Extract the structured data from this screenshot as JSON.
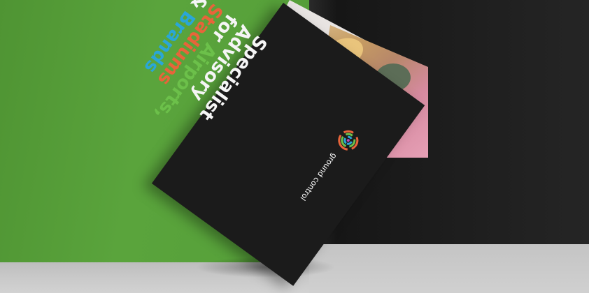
{
  "card": {
    "headline_lines": [
      [
        {
          "text": "Specialist",
          "color": "white"
        }
      ],
      [
        {
          "text": "Advisory",
          "color": "white"
        }
      ],
      [
        {
          "text": "for ",
          "color": "white"
        },
        {
          "text": "Airports,",
          "color": "green"
        }
      ],
      [
        {
          "text": "Stadiums",
          "color": "orange"
        }
      ],
      [
        {
          "text": "& ",
          "color": "white"
        },
        {
          "text": "Brands",
          "color": "blue"
        }
      ]
    ],
    "brand_name": "ground control",
    "logo_icon": "concentric-ring-logo-icon"
  },
  "colors": {
    "green_wall": "#57a13a",
    "black_wall": "#1e1e1e",
    "card": "#1b1b1b",
    "text_white": "#f5f5f5",
    "accent_green": "#6cc04a",
    "accent_orange": "#e8643a",
    "accent_blue": "#2aa6d8"
  }
}
